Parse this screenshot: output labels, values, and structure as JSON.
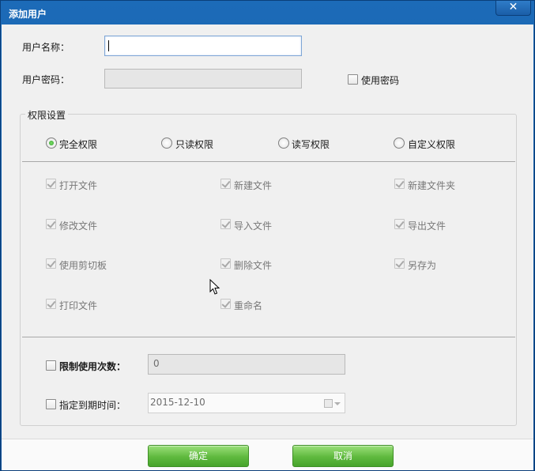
{
  "window": {
    "title": "添加用户",
    "close_glyph": "✕"
  },
  "form": {
    "username_label": "用户名称：",
    "username_value": "",
    "password_label": "用户密码：",
    "password_value": "",
    "use_password_label": "使用密码"
  },
  "permissions": {
    "group_title": "权限设置",
    "modes": [
      {
        "label": "完全权限",
        "selected": true
      },
      {
        "label": "只读权限",
        "selected": false
      },
      {
        "label": "读写权限",
        "selected": false
      },
      {
        "label": "自定义权限",
        "selected": false
      }
    ],
    "items": [
      {
        "label": "打开文件",
        "checked": true
      },
      {
        "label": "新建文件",
        "checked": true
      },
      {
        "label": "新建文件夹",
        "checked": true
      },
      {
        "label": "修改文件",
        "checked": true
      },
      {
        "label": "导入文件",
        "checked": true
      },
      {
        "label": "导出文件",
        "checked": true
      },
      {
        "label": "使用剪切板",
        "checked": true
      },
      {
        "label": "删除文件",
        "checked": true
      },
      {
        "label": "另存为",
        "checked": true
      },
      {
        "label": "打印文件",
        "checked": true
      },
      {
        "label": "重命名",
        "checked": true
      }
    ]
  },
  "limits": {
    "use_count_label": "限制使用次数：",
    "use_count_value": "0",
    "expire_label": "指定到期时间：",
    "expire_value": "2015-12-10"
  },
  "buttons": {
    "ok_label": "确定",
    "cancel_label": "取消"
  }
}
